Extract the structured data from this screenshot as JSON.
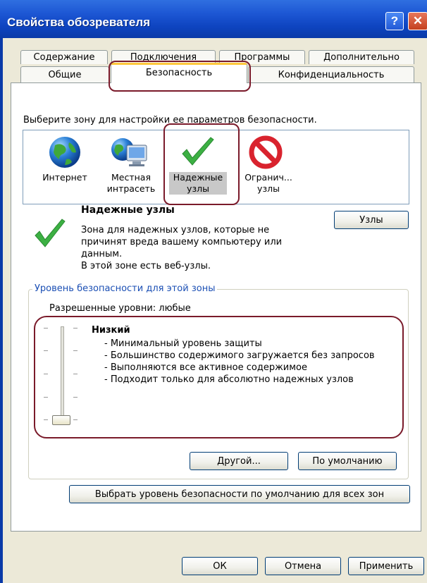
{
  "window": {
    "title": "Свойства обозревателя",
    "help_glyph": "?",
    "close_glyph": "✕"
  },
  "tabs_row1": [
    "Содержание",
    "Подключения",
    "Программы",
    "Дополнительно"
  ],
  "tabs_row2": [
    "Общие",
    "Безопасность",
    "Конфиденциальность"
  ],
  "zone_section": {
    "instruction": "Выберите зону для настройки ее параметров безопасности.",
    "zones": [
      {
        "label": "Интернет",
        "icon": "globe-icon"
      },
      {
        "label": "Местная интрасеть",
        "icon": "intranet-icon"
      },
      {
        "label": "Надежные узлы",
        "icon": "checkmark-icon"
      },
      {
        "label": "Огранич... узлы",
        "icon": "restricted-icon"
      }
    ]
  },
  "selected_zone": {
    "title": "Надежные узлы",
    "description_lines": [
      "Зона для надежных узлов, которые не",
      "причинят вреда вашему компьютеру или",
      "данным.",
      "В этой зоне есть веб-узлы."
    ],
    "sites_button": "Узлы"
  },
  "security_level": {
    "group_title": "Уровень безопасности для этой зоны",
    "allowed_levels": "Разрешенные уровни: любые",
    "level_name": "Низкий",
    "details": [
      "- Минимальный уровень защиты",
      "- Большинство содержимого загружается без запросов",
      "- Выполняются все активное содержимое",
      "- Подходит только для абсолютно надежных узлов"
    ],
    "slider_level": 0.0,
    "custom_button": "Другой...",
    "default_button": "По умолчанию",
    "reset_all_button": "Выбрать уровень безопасности по умолчанию для всех зон"
  },
  "footer": {
    "ok": "ОК",
    "cancel": "Отмена",
    "apply": "Применить"
  }
}
